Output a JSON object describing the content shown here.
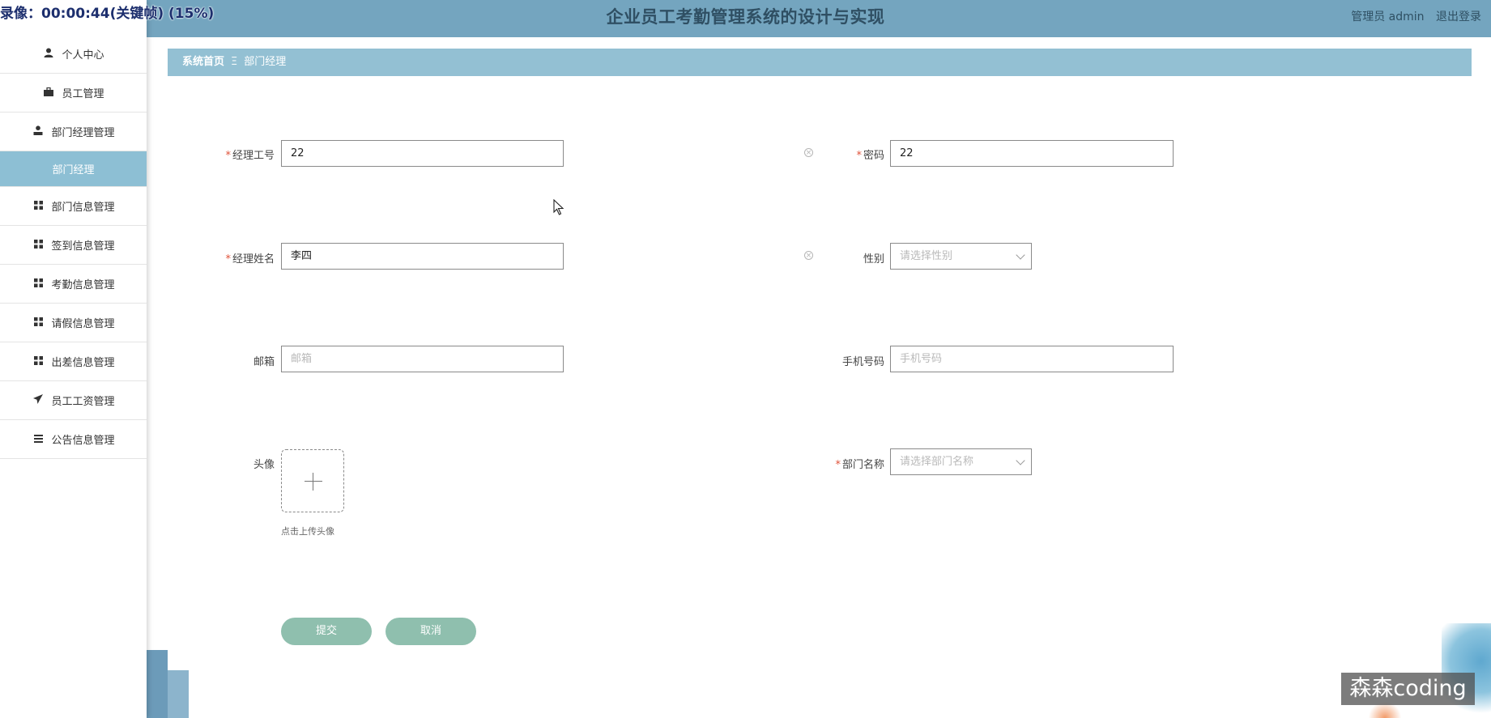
{
  "header": {
    "title": "企业员工考勤管理系统的设计与实现",
    "role": "管理员 admin",
    "logout": "退出登录",
    "recording_status": "录像：00:00:44(关键帧) (15%)"
  },
  "sidebar": {
    "items": [
      {
        "label": "个人中心",
        "icon": "user-icon"
      },
      {
        "label": "员工管理",
        "icon": "briefcase-icon"
      },
      {
        "label": "部门经理管理",
        "icon": "user-tie-icon"
      },
      {
        "label": "部门经理",
        "icon": "",
        "sub": true
      },
      {
        "label": "部门信息管理",
        "icon": "grid-icon"
      },
      {
        "label": "签到信息管理",
        "icon": "grid-icon"
      },
      {
        "label": "考勤信息管理",
        "icon": "grid-icon"
      },
      {
        "label": "请假信息管理",
        "icon": "grid-icon"
      },
      {
        "label": "出差信息管理",
        "icon": "grid-icon"
      },
      {
        "label": "员工工资管理",
        "icon": "send-icon"
      },
      {
        "label": "公告信息管理",
        "icon": "list-icon"
      }
    ]
  },
  "breadcrumb": {
    "home": "系统首页",
    "separator": "Ξ",
    "current": "部门经理"
  },
  "form": {
    "manager_id": {
      "label": "经理工号",
      "value": "22",
      "required": true
    },
    "password": {
      "label": "密码",
      "value": "22",
      "required": true
    },
    "manager_name": {
      "label": "经理姓名",
      "value": "李四",
      "required": true
    },
    "gender": {
      "label": "性别",
      "placeholder": "请选择性别"
    },
    "email": {
      "label": "邮箱",
      "placeholder": "邮箱"
    },
    "phone": {
      "label": "手机号码",
      "placeholder": "手机号码"
    },
    "avatar": {
      "label": "头像",
      "hint": "点击上传头像"
    },
    "department": {
      "label": "部门名称",
      "placeholder": "请选择部门名称",
      "required": true
    }
  },
  "buttons": {
    "submit": "提交",
    "cancel": "取消"
  },
  "watermark": "森森coding",
  "colors": {
    "header_bg": "#74a5bf",
    "breadcrumb_bg": "#93c0d3",
    "sub_menu_bg": "#8dbfd4",
    "button_bg": "#8fbfae",
    "required": "#e0533a"
  }
}
